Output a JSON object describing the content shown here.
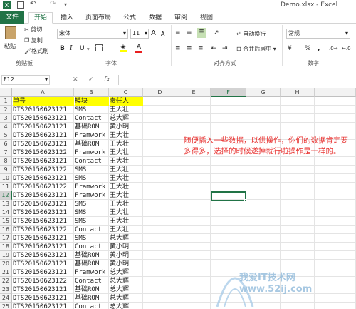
{
  "window": {
    "doc_title": "Demo.xlsx - Excel"
  },
  "tabs": [
    "文件",
    "开始",
    "插入",
    "页面布局",
    "公式",
    "数据",
    "审阅",
    "视图"
  ],
  "ribbon": {
    "paste": "粘贴",
    "cut": "剪切",
    "copy": "复制",
    "format_painter": "格式刷",
    "clipboard_group": "剪贴板",
    "font_name": "宋体",
    "font_size": "11",
    "font_group": "字体",
    "wrap_text": "自动换行",
    "merge_center": "合并后居中",
    "alignment_group": "对齐方式",
    "number_format": "常规",
    "number_group": "数字",
    "bold": "B",
    "italic": "I",
    "underline": "U",
    "font_color": "A",
    "grow_font": "A",
    "shrink_font": "A",
    "percent": "%",
    "comma": ",",
    "currency": "¥"
  },
  "formula_bar": {
    "name_box": "F12",
    "cancel": "✕",
    "enter": "✓",
    "fx": "fx",
    "formula": ""
  },
  "columns": [
    "A",
    "B",
    "C",
    "D",
    "E",
    "F",
    "G",
    "H",
    "I"
  ],
  "rows": [
    "1",
    "2",
    "3",
    "4",
    "5",
    "6",
    "7",
    "8",
    "9",
    "10",
    "11",
    "12",
    "13",
    "14",
    "15",
    "16",
    "17",
    "18",
    "19",
    "20",
    "21",
    "22",
    "23",
    "24",
    "25"
  ],
  "table": {
    "headers": [
      "单号",
      "模块",
      "责任人"
    ],
    "data": [
      [
        "DTS20150623121",
        "SMS",
        "王大壮"
      ],
      [
        "DTS20150623121",
        "Contact",
        "总大辉"
      ],
      [
        "DTS20150623121",
        "基础ROM",
        "黄小明"
      ],
      [
        "DTS20150623121",
        "Framwork",
        "王大壮"
      ],
      [
        "DTS20150623121",
        "基础ROM",
        "王大壮"
      ],
      [
        "DTS20150623122",
        "Framwork",
        "王大壮"
      ],
      [
        "DTS20150623121",
        "Contact",
        "王大壮"
      ],
      [
        "DTS20150623122",
        "SMS",
        "王大壮"
      ],
      [
        "DTS20150623121",
        "SMS",
        "王大壮"
      ],
      [
        "DTS20150623122",
        "Framwork",
        "王大壮"
      ],
      [
        "DTS20150623121",
        "Framwork",
        "王大壮"
      ],
      [
        "DTS20150623121",
        "SMS",
        "王大壮"
      ],
      [
        "DTS20150623121",
        "SMS",
        "王大壮"
      ],
      [
        "DTS20150623121",
        "SMS",
        "王大壮"
      ],
      [
        "DTS20150623122",
        "Contact",
        "王大壮"
      ],
      [
        "DTS20150623121",
        "SMS",
        "总大辉"
      ],
      [
        "DTS20150623121",
        "Contact",
        "黄小明"
      ],
      [
        "DTS20150623121",
        "基础ROM",
        "黄小明"
      ],
      [
        "DTS20150623121",
        "基础ROM",
        "黄小明"
      ],
      [
        "DTS20150623121",
        "Framwork",
        "总大辉"
      ],
      [
        "DTS20150623122",
        "Contact",
        "总大辉"
      ],
      [
        "DTS20150623121",
        "基础ROM",
        "总大辉"
      ],
      [
        "DTS20150623121",
        "基础ROM",
        "总大辉"
      ],
      [
        "DTS20150623121",
        "Contact",
        "总大辉"
      ]
    ]
  },
  "note": "随便插入一些数据，以供操作，你们的数据肯定要多得多，选择的时候遂掉就行啦操作是一样的。",
  "watermark": "我爱IT技术网 www.52ij.com",
  "colors": {
    "excel_green": "#217346",
    "header_fill": "#ffff00",
    "note_text": "#e8312f",
    "selection": "#217346"
  }
}
